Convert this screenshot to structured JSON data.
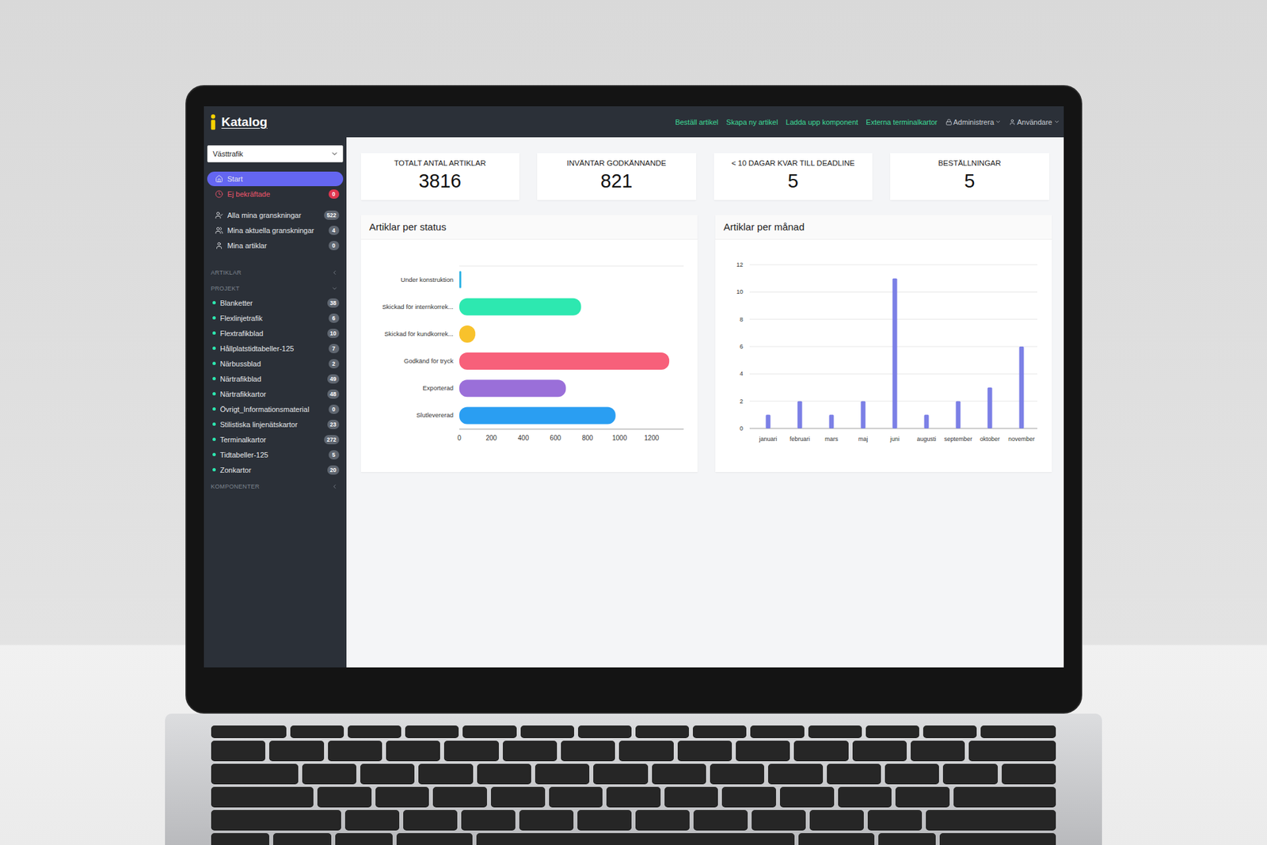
{
  "app": {
    "logo": "Katalog",
    "organization": "Västtrafik"
  },
  "top_nav": {
    "links": [
      "Beställ artikel",
      "Skapa ny artikel",
      "Ladda upp komponent",
      "Externa terminalkartor"
    ],
    "menus": [
      {
        "label": "Administrera",
        "kind": "lock"
      },
      {
        "label": "Användare",
        "kind": "user"
      }
    ]
  },
  "sidebar": {
    "nav": [
      {
        "label": "Start",
        "badge": "",
        "selected": true,
        "kind": "home"
      },
      {
        "label": "Ej bekräftade",
        "badge": "0",
        "selected": false,
        "kind": "alert"
      }
    ],
    "reviews": [
      {
        "label": "Alla mina granskningar",
        "badge": "522",
        "selected": false,
        "kind": "review"
      },
      {
        "label": "Mina aktuella granskningar",
        "badge": "4",
        "selected": false,
        "kind": "reviews"
      },
      {
        "label": "Mina artiklar",
        "badge": "0",
        "selected": false,
        "kind": "articles"
      }
    ],
    "sections": [
      {
        "label": "ARTIKLAR",
        "expanded": false,
        "items": []
      },
      {
        "label": "PROJEKT",
        "expanded": true,
        "items": [
          {
            "label": "Blanketter",
            "badge": "38",
            "selected": false
          },
          {
            "label": "Flexlinjetrafik",
            "badge": "6",
            "selected": false
          },
          {
            "label": "Flextrafikblad",
            "badge": "10",
            "selected": false
          },
          {
            "label": "Hållplatstidtabeller-125",
            "badge": "7",
            "selected": false
          },
          {
            "label": "Närbussblad",
            "badge": "2",
            "selected": false
          },
          {
            "label": "Närtrafikblad",
            "badge": "49",
            "selected": false
          },
          {
            "label": "Närtrafikkartor",
            "badge": "48",
            "selected": false
          },
          {
            "label": "Övrigt_Informationsmaterial",
            "badge": "0",
            "selected": false
          },
          {
            "label": "Stilistiska linjenätskartor",
            "badge": "23",
            "selected": false
          },
          {
            "label": "Terminalkartor",
            "badge": "272",
            "selected": false
          },
          {
            "label": "Tidtabeller-125",
            "badge": "5",
            "selected": false
          },
          {
            "label": "Zonkartor",
            "badge": "20",
            "selected": false
          }
        ]
      },
      {
        "label": "KOMPONENTER",
        "expanded": false,
        "items": []
      }
    ]
  },
  "stats": [
    {
      "label": "TOTALT ANTAL ARTIKLAR",
      "value": "3816"
    },
    {
      "label": "INVÄNTAR GODKÄNNANDE",
      "value": "821"
    },
    {
      "label": "< 10 DAGAR KVAR TILL DEADLINE",
      "value": "5"
    },
    {
      "label": "BESTÄLLNINGAR",
      "value": "5"
    }
  ],
  "status_chart": {
    "title": "Artiklar per status",
    "x_ticks": [
      "0",
      "200",
      "400",
      "600",
      "800",
      "1000",
      "1200"
    ],
    "bars": [
      {
        "label": "Under konstruktion",
        "value": 10,
        "color": "#33b5e5"
      },
      {
        "label": "Skickad för internkorrek...",
        "value": 760,
        "color": "#2de8b0"
      },
      {
        "label": "Skickad för kundkorrek...",
        "value": 100,
        "color": "#f8c22c"
      },
      {
        "label": "Godkänd för tryck",
        "value": 1310,
        "color": "#f7607a"
      },
      {
        "label": "Exporterad",
        "value": 665,
        "color": "#9a6fd9"
      },
      {
        "label": "Slutlevererad",
        "value": 975,
        "color": "#2a9ef2"
      }
    ]
  },
  "month_chart": {
    "title": "Artiklar per månad",
    "y_ticks": [
      "0",
      "2",
      "4",
      "6",
      "8",
      "10",
      "12"
    ],
    "bars": [
      {
        "label": "januari",
        "value": 1
      },
      {
        "label": "februari",
        "value": 2
      },
      {
        "label": "mars",
        "value": 1
      },
      {
        "label": "maj",
        "value": 2
      },
      {
        "label": "juni",
        "value": 11
      },
      {
        "label": "augusti",
        "value": 1
      },
      {
        "label": "september",
        "value": 2
      },
      {
        "label": "oktober",
        "value": 3
      },
      {
        "label": "november",
        "value": 6
      }
    ]
  }
}
